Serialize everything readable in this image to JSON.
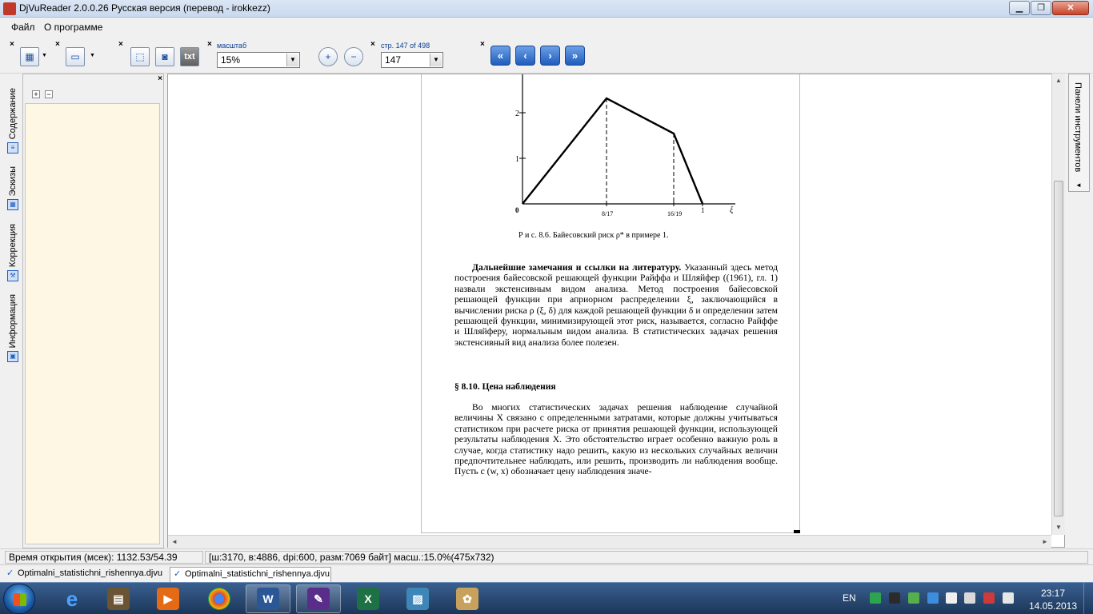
{
  "window": {
    "title": "DjVuReader 2.0.0.26 Русская версия (перевод - irokkezz)",
    "controls": {
      "minimize": "▁",
      "maximize": "❐",
      "close": "✕"
    }
  },
  "menu": {
    "items": [
      "Файл",
      "О программе"
    ]
  },
  "toolbar": {
    "close_glyph": "×",
    "scale_label": "масштаб",
    "scale_value": "15%",
    "page_label": "стр. 147 of 498",
    "page_value": "147",
    "txt_label": "txt",
    "zoom_in": "+",
    "zoom_out": "−",
    "nav": {
      "first": "«",
      "prev": "‹",
      "next": "›",
      "last": "»"
    }
  },
  "sidebar": {
    "tabs": [
      "Содержание",
      "Эскизы",
      "Коррекция",
      "Информация"
    ],
    "expand": "+",
    "collapse": "−",
    "close": "×"
  },
  "right_panel": {
    "label": "Панели инструментов",
    "arrow": "◄"
  },
  "document": {
    "figure": {
      "y_ticks": [
        "2",
        "1"
      ],
      "x_ticks": [
        "0",
        "8/17",
        "16/19",
        "1",
        "ξ"
      ],
      "caption": "Р и с.  8.6.  Байесовский риск ρ* в примере 1."
    },
    "para1_bold": "Дальнейшие замечания и ссылки на литературу.",
    "para1_text": " Указанный здесь метод построения байесовской решающей функции Райффа и Шляйфер ((1961), гл. 1) назвали экстенсивным видом анализа. Метод построения байесовской решающей функции при априорном распределении ξ, заключающийся в вычислении риска ρ (ξ, δ) для каждой решающей функции δ и определении затем решающей функции, минимизирующей этот риск, называется, согласно Райффе и Шляйферу, нормальным видом анализа. В статистических задачах решения экстенсивный вид анализа более полезен.",
    "heading": "§ 8.10.  Цена наблюдения",
    "para2_text": "Во многих статистических задачах решения наблюдение случайной величины X связано с определенными затратами, которые должны учитываться статистиком при расчете риска от принятия решающей функции, использующей результаты наблюдения X. Это обстоятельство играет особенно важную роль в случае, когда статистику надо решить, какую из нескольких случайных величин предпочтительнее наблюдать, или решить, производить ли наблюдения вообще. Пусть c (w, x) обозначает цену наблюдения значе-"
  },
  "status": {
    "open_time": "Время открытия (мсек): 1132.53/54.39",
    "info": "[ш:3170, в:4886, dpi:600, разм:7069 байт] масш.:15.0%(475x732)"
  },
  "doc_tabs": [
    "Optimalni_statistichni_rishennya.djvu",
    "Optimalni_statistichni_rishennya.djvu"
  ],
  "taskbar": {
    "lang": "EN",
    "time": "23:17",
    "date": "14.05.2013"
  },
  "colors": {
    "accent": "#1f5dbd",
    "panel_bg": "#fdf7e4",
    "taskbar": "#1c3659"
  }
}
